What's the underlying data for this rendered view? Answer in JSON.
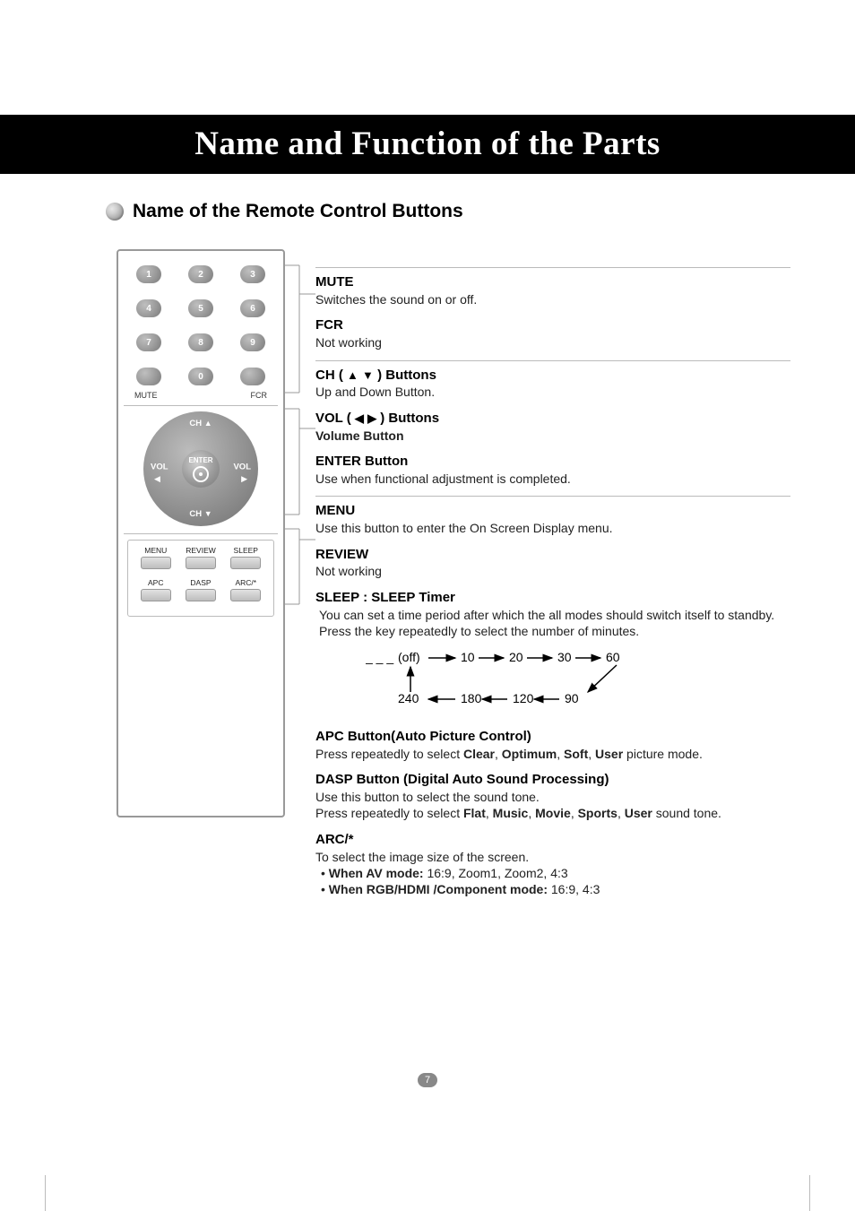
{
  "page": {
    "title": "Name and Function of the Parts",
    "section_title": "Name of the Remote Control Buttons",
    "number": "7"
  },
  "remote": {
    "keys": [
      "1",
      "2",
      "3",
      "4",
      "5",
      "6",
      "7",
      "8",
      "9",
      "",
      "0",
      ""
    ],
    "mute_label": "MUTE",
    "fcr_label": "FCR",
    "nav": {
      "ch": "CH",
      "vol": "VOL",
      "enter": "ENTER"
    },
    "lower_buttons_row1": [
      "MENU",
      "REVIEW",
      "SLEEP"
    ],
    "lower_buttons_row2": [
      "APC",
      "DASP",
      "ARC/*"
    ]
  },
  "desc": {
    "mute": {
      "h": "MUTE",
      "body": "Switches the sound on or off."
    },
    "fcr": {
      "h": "FCR",
      "body": "Not working"
    },
    "ch": {
      "h_pre": "CH ( ",
      "h_post": " ) Buttons",
      "body": "Up and Down Button."
    },
    "vol": {
      "h_pre": "VOL ( ",
      "h_post": " ) Buttons",
      "body": "Volume Button"
    },
    "enter": {
      "h": "ENTER Button",
      "body": "Use when functional adjustment is completed."
    },
    "menu": {
      "h": "MENU",
      "body": "Use this button to enter the On Screen Display menu."
    },
    "review": {
      "h": "REVIEW",
      "body": "Not working"
    },
    "sleep": {
      "h": "SLEEP : SLEEP Timer",
      "line1": "You can set a time period after which the all modes should switch itself to standby.",
      "line2": "Press the key repeatedly to select the number of minutes.",
      "sequence_top": [
        "(off)",
        "10",
        "20",
        "30",
        "60"
      ],
      "sequence_bottom": [
        "240",
        "180",
        "120",
        "90"
      ],
      "off_prefix": "_ _ _"
    },
    "apc": {
      "h": "APC Button(Auto Picture Control)",
      "body_pre": "Press repeatedly to select ",
      "opts": [
        "Clear",
        "Optimum",
        "Soft",
        "User"
      ],
      "body_post": " picture mode."
    },
    "dasp": {
      "h": "DASP Button (Digital Auto Sound Processing)",
      "line1": "Use this button to select the sound tone.",
      "body_pre": "Press repeatedly to select ",
      "opts": [
        "Flat",
        "Music",
        "Movie",
        "Sports",
        "User"
      ],
      "body_post": " sound tone."
    },
    "arc": {
      "h": "ARC/*",
      "line1": "To select the image size of the screen.",
      "bul1_label": "When AV mode:",
      "bul1_vals": " 16:9, Zoom1, Zoom2, 4:3",
      "bul2_label": "When RGB/HDMI /Component mode:",
      "bul2_vals": " 16:9, 4:3"
    }
  }
}
